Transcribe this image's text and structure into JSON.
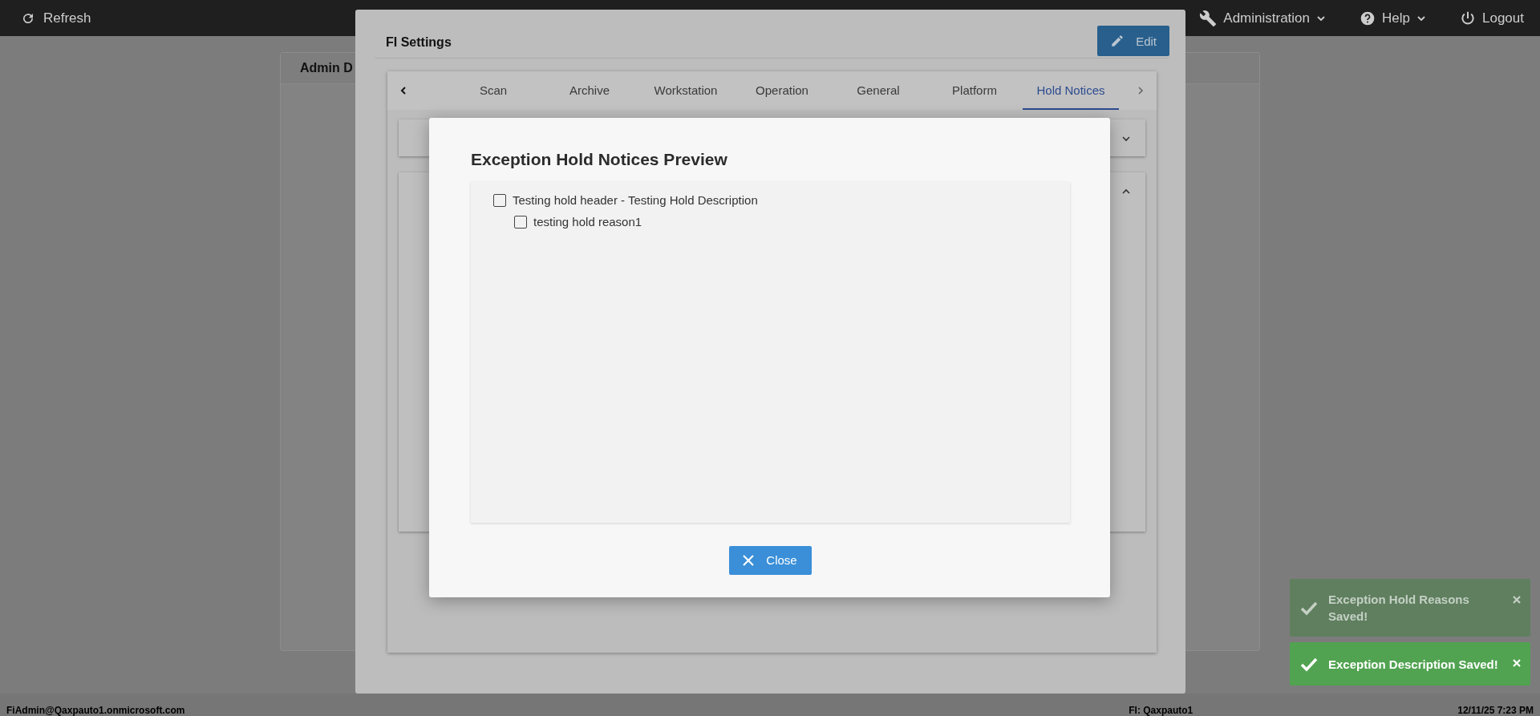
{
  "top_bar": {
    "refresh": "Refresh",
    "menus": [
      {
        "kind": "admin",
        "label": "Administration"
      },
      {
        "kind": "help",
        "label": "Help"
      },
      {
        "kind": "logout",
        "label": "Logout"
      }
    ]
  },
  "background_card": {
    "title": "Admin D"
  },
  "settings_modal": {
    "title": "FI Settings",
    "edit_button": "Edit",
    "tabs": [
      {
        "label": "Scan",
        "selected": false
      },
      {
        "label": "Archive",
        "selected": false
      },
      {
        "label": "Workstation",
        "selected": false
      },
      {
        "label": "Operation",
        "selected": false
      },
      {
        "label": "General",
        "selected": false
      },
      {
        "label": "Platform",
        "selected": false
      },
      {
        "label": "Hold Notices",
        "selected": true
      }
    ],
    "panels": [
      {
        "expanded": false
      },
      {
        "expanded": true
      }
    ]
  },
  "preview_dialog": {
    "title": "Exception Hold Notices Preview",
    "items": [
      {
        "label": "Testing hold header - Testing Hold Description",
        "checked": false,
        "children": [
          {
            "label": "testing hold reason1",
            "checked": false
          }
        ]
      }
    ],
    "close_button": "Close"
  },
  "toasts": [
    {
      "message": "Exception Hold Reasons Saved!",
      "faded": true
    },
    {
      "message": "Exception Description Saved!",
      "faded": false
    }
  ],
  "status_bar": {
    "user": "FiAdmin@Qaxpauto1.onmicrosoft.com",
    "fi": "FI: Qaxpauto1",
    "datetime": "12/11/25 7:23 PM"
  }
}
